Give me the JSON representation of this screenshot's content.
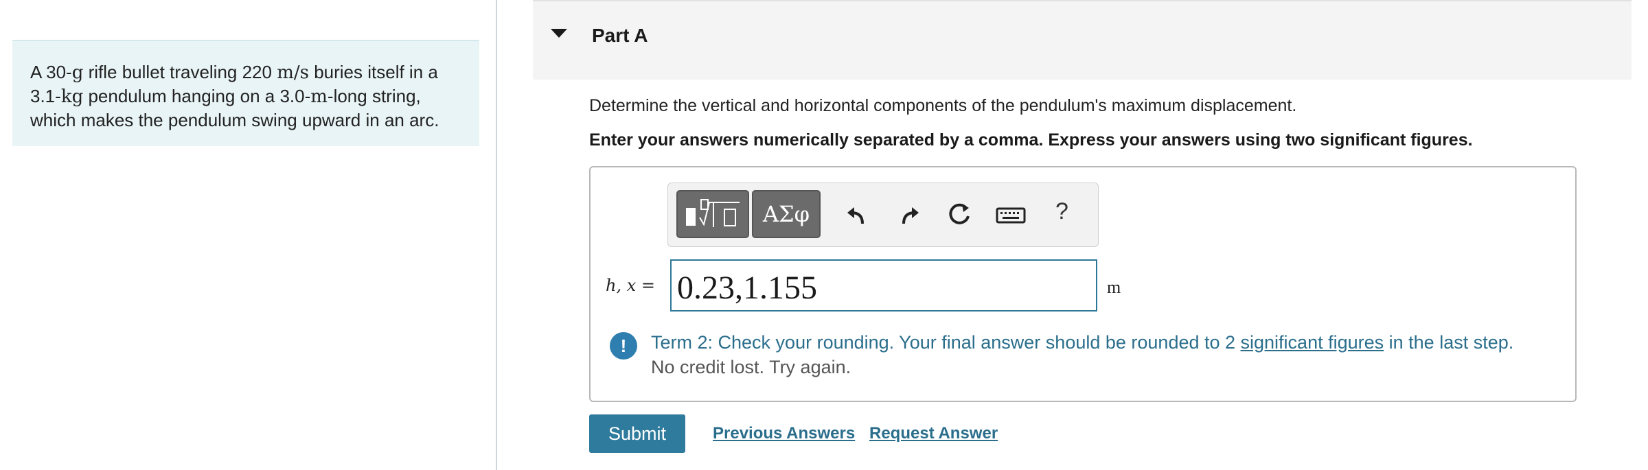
{
  "problem": {
    "pre": "A 30-",
    "mass_unit": "g",
    "mid1": " rifle bullet traveling 220 ",
    "speed_unit": "m/s",
    "mid2": " buries itself in a 3.1-",
    "kg_unit": "kg",
    "mid3": " pendulum hanging on a 3.0-",
    "len_unit": "m",
    "end": "-long string, which makes the pendulum swing upward in an arc."
  },
  "part": {
    "title": "Part A",
    "question": "Determine the vertical and horizontal components of the pendulum's maximum displacement.",
    "instructions": "Enter your answers numerically separated by a comma. Express your answers using two significant figures."
  },
  "toolbar": {
    "symbols_label": "ΑΣφ",
    "templates_icon": "templates-icon",
    "undo_icon": "undo-icon",
    "redo_icon": "redo-icon",
    "reset_icon": "reset-icon",
    "keyboard_icon": "keyboard-icon",
    "help_label": "?"
  },
  "answer": {
    "variable_label": "h, x =",
    "value": "0.23,1.155",
    "unit": "m"
  },
  "feedback": {
    "main_pre": "Term 2: Check your rounding. Your final answer should be rounded to 2 ",
    "link": "significant figures",
    "main_post": " in the last step.",
    "sub": "No credit lost. Try again."
  },
  "actions": {
    "submit": "Submit",
    "previous": "Previous Answers",
    "request": "Request Answer"
  },
  "colors": {
    "accent": "#2f7b9d",
    "panel_bg": "#e9f4f6",
    "feedback_text": "#2a6e8c"
  }
}
